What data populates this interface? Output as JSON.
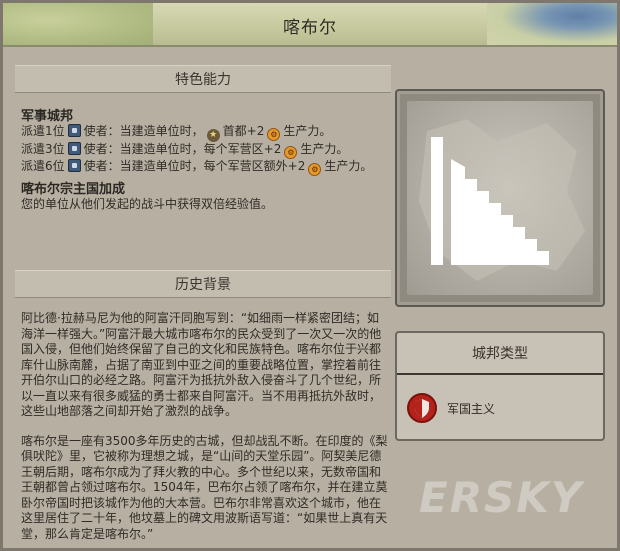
{
  "header": {
    "title": "喀布尔"
  },
  "abilities": {
    "section_title": "特色能力",
    "military_title": "军事城邦",
    "rows": [
      {
        "lead": "派遣1位",
        "text_a": "使者：当建造单位时，",
        "text_b": "首都+2",
        "text_c": "生产力。"
      },
      {
        "lead": "派遣3位",
        "text_a": "使者：当建造单位时，每个军营区+2",
        "text_c": "生产力。"
      },
      {
        "lead": "派遣6位",
        "text_a": "使者：当建造单位时，每个军营区额外+2",
        "text_c": "生产力。"
      }
    ],
    "suzerain_title": "喀布尔宗主国加成",
    "suzerain_text": "您的单位从他们发起的战斗中获得双倍经验值。"
  },
  "history": {
    "section_title": "历史背景",
    "paragraphs": [
      "阿比德·拉赫马尼为他的阿富汗同胞写到：“如细雨一样紧密团结；如海洋一样强大。”阿富汗最大城市喀布尔的民众受到了一次又一次的他国入侵，但他们始终保留了自己的文化和民族特色。喀布尔位于兴都库什山脉南麓，占据了南亚到中亚之间的重要战略位置，掌控着前往开伯尔山口的必经之路。阿富汗为抵抗外敌入侵奋斗了几个世纪，所以一直以来有很多威猛的勇士都来自阿富汗。当不用再抵抗外敌时，这些山地部落之间却开始了激烈的战争。",
      "喀布尔是一座有3500多年历史的古城，但却战乱不断。在印度的《梨俱吠陀》里，它被称为理想之城，是“山间的天堂乐园”。阿契美尼德王朝后期，喀布尔成为了拜火教的中心。多个世纪以来，无数帝国和王朝都曾占领过喀布尔。1504年，巴布尔占领了喀布尔，并在建立莫卧尔帝国时把该城作为他的大本营。巴布尔非常喜欢这个城市，他在这里居住了二十年，他坟墓上的碑文用波斯语写道：“如果世上真有天堂，那么肯定是喀布尔。”"
    ]
  },
  "city_state_type": {
    "section_title": "城邦类型",
    "label": "军国主义",
    "color": "#b3231c"
  },
  "icons": {
    "envoy": "envoy-icon",
    "capital": "capital-star-icon",
    "production": "production-icon",
    "militaristic": "militaristic-shield-icon"
  },
  "watermark": "ERSKY"
}
